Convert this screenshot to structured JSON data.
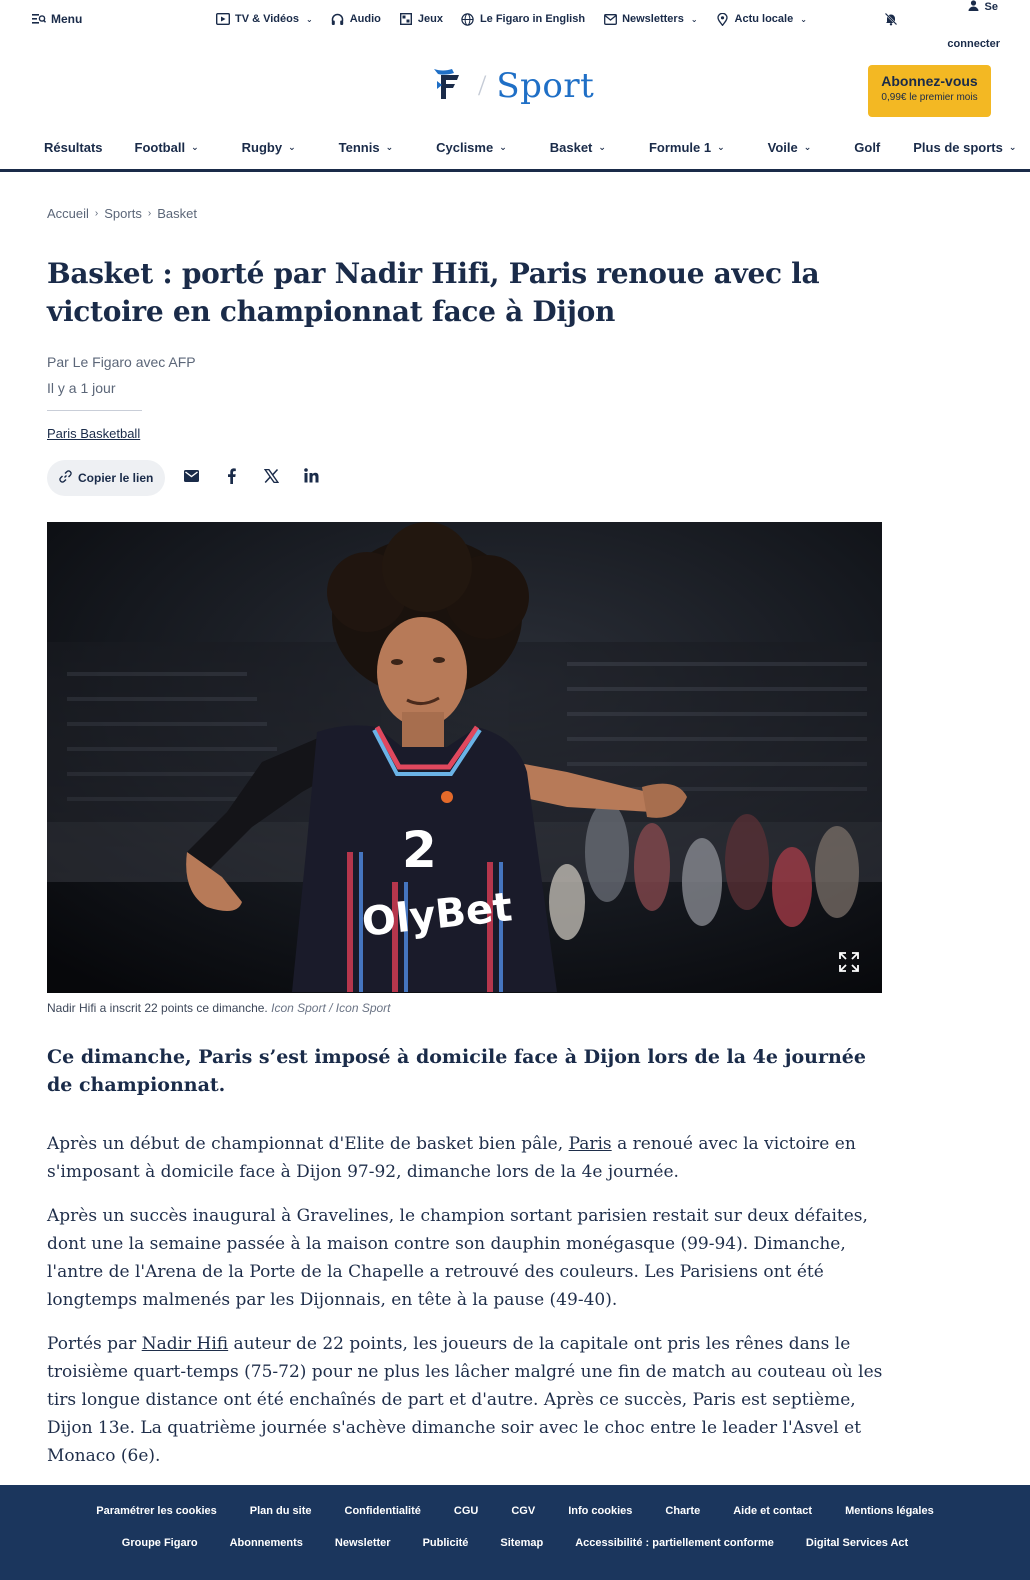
{
  "topbar": {
    "menu": "Menu",
    "utils": [
      {
        "label": "TV & Vidéos",
        "icon": "play-icon",
        "dropdown": true
      },
      {
        "label": "Audio",
        "icon": "headphones-icon",
        "dropdown": false
      },
      {
        "label": "Jeux",
        "icon": "games-icon",
        "dropdown": false
      },
      {
        "label": "Le Figaro in English",
        "icon": "globe-icon",
        "dropdown": false
      },
      {
        "label": "Newsletters",
        "icon": "mail-icon",
        "dropdown": true
      },
      {
        "label": "Actu locale",
        "icon": "location-icon",
        "dropdown": true
      }
    ],
    "login_line1": "Se",
    "login_line2": "connecter"
  },
  "brand": {
    "section": "Sport",
    "subscribe_title": "Abonnez-vous",
    "subscribe_sub": "0,99€ le premier mois",
    "accent": "#f3b823",
    "section_color": "#1f6fc6",
    "navy": "#1a2b49"
  },
  "sportnav": [
    {
      "label": "Résultats",
      "dropdown": false
    },
    {
      "label": "Football",
      "dropdown": true
    },
    {
      "label": "Rugby",
      "dropdown": true
    },
    {
      "label": "Tennis",
      "dropdown": true
    },
    {
      "label": "Cyclisme",
      "dropdown": true
    },
    {
      "label": "Basket",
      "dropdown": true
    },
    {
      "label": "Formule 1",
      "dropdown": true
    },
    {
      "label": "Voile",
      "dropdown": true
    },
    {
      "label": "Golf",
      "dropdown": false
    },
    {
      "label": "Plus de sports",
      "dropdown": true
    }
  ],
  "breadcrumb": [
    "Accueil",
    "Sports",
    "Basket"
  ],
  "article": {
    "title": "Basket : porté par Nadir Hifi, Paris renoue avec la victoire en championnat face à Dijon",
    "author": "Par Le Figaro avec AFP",
    "date": "Il y a 1 jour",
    "tag": "Paris Basketball",
    "copy_link": "Copier le lien",
    "caption_text": "Nadir Hifi a inscrit 22 points ce dimanche.",
    "caption_credit": "Icon Sport / Icon Sport",
    "jersey_number": "2",
    "jersey_sponsor": "OlyBet",
    "lead": "Ce dimanche, Paris s’est imposé à domicile face à Dijon lors de la 4e journée de championnat.",
    "p1_a": "Après un début de championnat d'Elite de basket bien pâle, ",
    "p1_link": "Paris",
    "p1_b": " a renoué avec la victoire en s'imposant à domicile face à Dijon 97-92, dimanche lors de la 4e journée.",
    "p2": "Après un succès inaugural à Gravelines, le champion sortant parisien restait sur deux défaites, dont une la semaine passée à la maison contre son dauphin monégasque (99-94). Dimanche, l'antre de l'Arena de la Porte de la Chapelle a retrouvé des couleurs. Les Parisiens ont été longtemps malmenés par les Dijonnais, en tête à la pause (49-40).",
    "p3_a": "Portés par ",
    "p3_link": "Nadir Hifi",
    "p3_b": " auteur de 22 points, les joueurs de la capitale ont pris les rênes dans le troisième quart-temps (75-72) pour ne plus les lâcher malgré une fin de match au couteau où les tirs longue distance ont été enchaînés de part et d'autre. Après ce succès, Paris est septième, Dijon 13e. La quatrième journée s'achève dimanche soir avec le choc entre le leader l'Asvel et Monaco (6e)."
  },
  "footer": {
    "row1": [
      "Paramétrer les cookies",
      "Plan du site",
      "Confidentialité",
      "CGU",
      "CGV",
      "Info cookies",
      "Charte",
      "Aide et contact",
      "Mentions légales"
    ],
    "row2": [
      "Groupe Figaro",
      "Abonnements",
      "Newsletter",
      "Publicité",
      "Sitemap",
      "Accessibilité : partiellement conforme",
      "Digital Services Act"
    ],
    "bg": "#1b365d"
  }
}
